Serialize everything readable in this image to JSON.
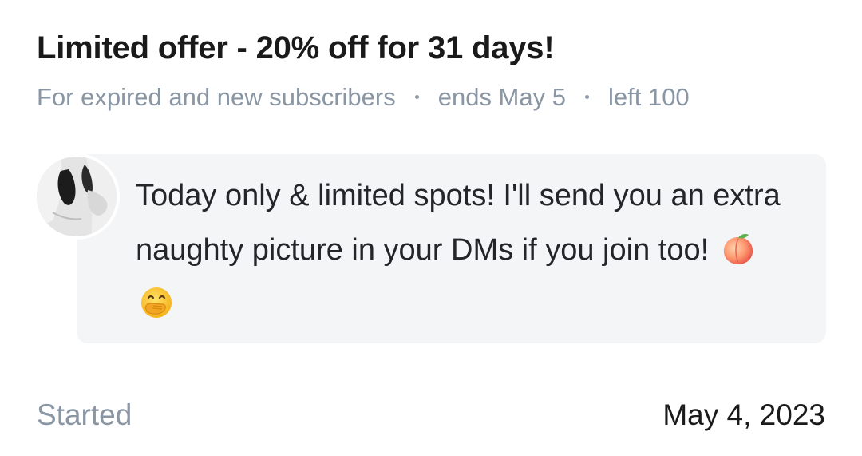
{
  "offer": {
    "title": "Limited offer - 20% off for 31 days!",
    "audience": "For expired and new subscribers",
    "ends": "ends May 5",
    "remaining": "left 100"
  },
  "message": {
    "text": "Today only & limited spots! I'll send you an extra naughty picture in your DMs if you join too!",
    "emojis": [
      "peach-emoji",
      "face-with-hand-over-mouth-emoji"
    ]
  },
  "avatar": {
    "icon": "creator-avatar"
  },
  "footer": {
    "started_label": "Started",
    "started_date": "May 4, 2023"
  },
  "colors": {
    "muted_text": "#8a96a3",
    "bubble_bg": "#f4f5f7",
    "primary_text": "#1a1a1a"
  }
}
